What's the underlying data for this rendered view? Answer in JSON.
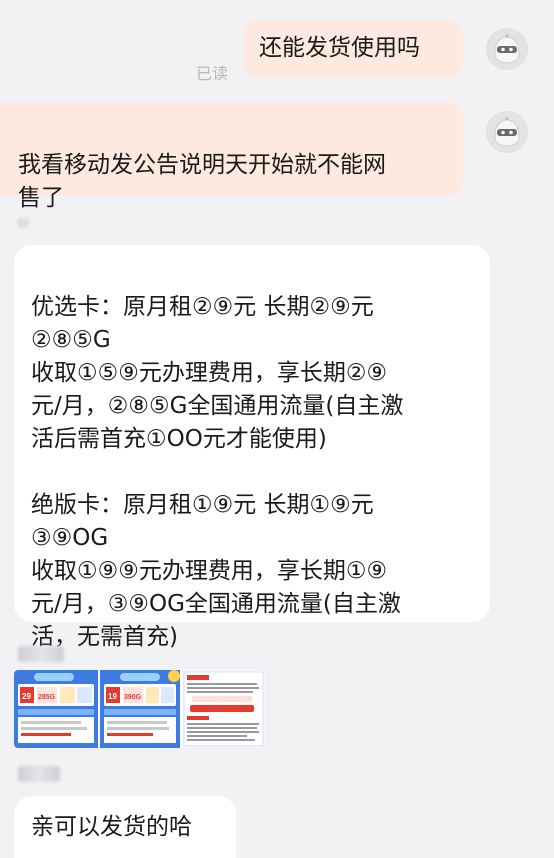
{
  "messages": {
    "m1": {
      "text": "还能发货使用吗",
      "read_status": "已读"
    },
    "m2": {
      "text": "我看移动发公告说明天开始就不能网\n售了"
    },
    "m3": {
      "text": "优选卡：原月租②⑨元  长期②⑨元\n②⑧⑤G\n收取①⑤⑨元办理费用，享长期②⑨\n元/月，②⑧⑤G全国通用流量(自主激\n活后需首充①OO元才能使用)\n\n绝版卡：原月租①⑨元  长期①⑨元\n③⑨OG\n收取①⑨⑨元办理费用，享长期①⑨\n元/月，③⑨OG全国通用流量(自主激\n活，无需首充)"
    },
    "m4": {
      "text": "亲可以发货的哈"
    }
  },
  "promo": {
    "card1": {
      "price": "29",
      "data": "285G"
    },
    "card2": {
      "price": "19",
      "data": "390G"
    },
    "panel_title": "购卡须知",
    "panel_button": "下单后必须先激活再发货",
    "panel_section": "选购指南"
  },
  "colors": {
    "outgoing_bubble": "#fde9df",
    "incoming_bubble": "#ffffff",
    "background": "#f2f2f4",
    "promo_blue": "#3d7be0",
    "promo_red": "#e43b2f"
  }
}
